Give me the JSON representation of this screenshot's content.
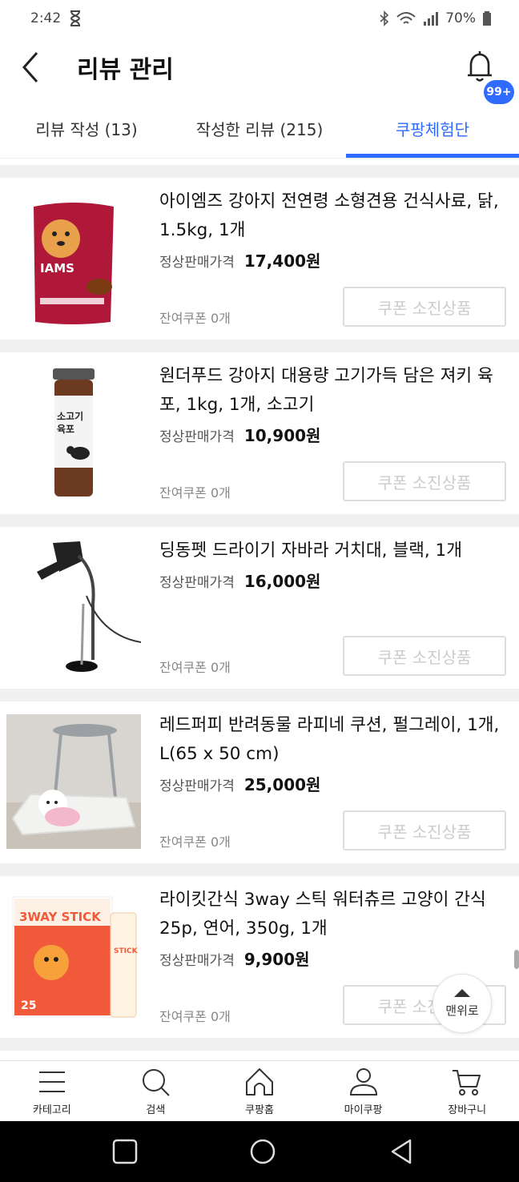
{
  "status_bar": {
    "time": "2:42",
    "battery": "70%"
  },
  "header": {
    "title": "리뷰 관리",
    "badge": "99+"
  },
  "tabs": [
    {
      "label": "리뷰 작성 (13)"
    },
    {
      "label": "작성한 리뷰 (215)"
    },
    {
      "label": "쿠팡체험단"
    }
  ],
  "products": [
    {
      "name": "아이엠즈 강아지 전연령 소형견용 건식사료, 닭, 1.5kg, 1개",
      "price_label": "정상판매가격",
      "price": "17,400원",
      "coupon_left": "잔여쿠폰 0개",
      "button": "쿠폰 소진상품"
    },
    {
      "name": "원더푸드 강아지 대용량 고기가득 담은 져키 육포, 1kg, 1개, 소고기",
      "price_label": "정상판매가격",
      "price": "10,900원",
      "coupon_left": "잔여쿠폰 0개",
      "button": "쿠폰 소진상품"
    },
    {
      "name": "딩동펫 드라이기 자바라 거치대, 블랙, 1개",
      "price_label": "정상판매가격",
      "price": "16,000원",
      "coupon_left": "잔여쿠폰 0개",
      "button": "쿠폰 소진상품"
    },
    {
      "name": "레드퍼피 반려동물 라피네 쿠션, 펄그레이, 1개, L(65 x 50 cm)",
      "price_label": "정상판매가격",
      "price": "25,000원",
      "coupon_left": "잔여쿠폰 0개",
      "button": "쿠폰 소진상품"
    },
    {
      "name": "라이킷간식 3way 스틱 워터츄르 고양이 간식 25p, 연어, 350g, 1개",
      "price_label": "정상판매가격",
      "price": "9,900원",
      "coupon_left": "잔여쿠폰 0개",
      "button": "쿠폰 소진상품"
    }
  ],
  "to_top": "맨위로",
  "bottom_nav": [
    {
      "label": "카테고리",
      "icon": "menu-icon"
    },
    {
      "label": "검색",
      "icon": "search-icon"
    },
    {
      "label": "쿠팡홈",
      "icon": "home-icon"
    },
    {
      "label": "마이쿠팡",
      "icon": "user-icon"
    },
    {
      "label": "장바구니",
      "icon": "cart-icon"
    }
  ]
}
